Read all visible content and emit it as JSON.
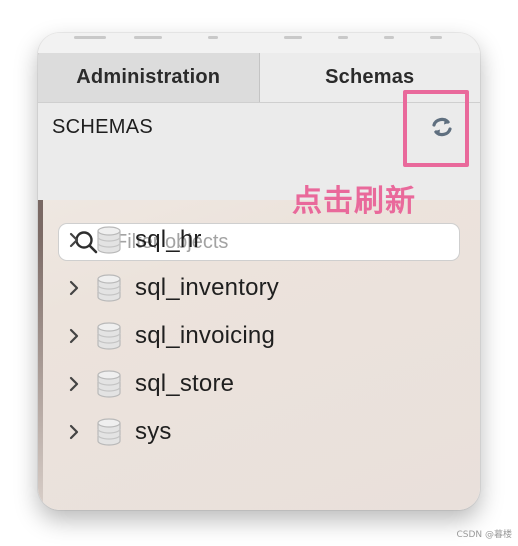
{
  "tabs": [
    {
      "label": "Administration"
    },
    {
      "label": "Schemas"
    }
  ],
  "header": {
    "title": "SCHEMAS",
    "refresh_icon": "refresh-icon"
  },
  "filter": {
    "placeholder": "Filter objects",
    "value": ""
  },
  "annotation": {
    "text": "点击刷新",
    "color": "#e9699b"
  },
  "schemas": [
    {
      "name": "sql_hr"
    },
    {
      "name": "sql_inventory"
    },
    {
      "name": "sql_invoicing"
    },
    {
      "name": "sql_store"
    },
    {
      "name": "sys"
    }
  ],
  "watermark": "CSDN @暮楼"
}
